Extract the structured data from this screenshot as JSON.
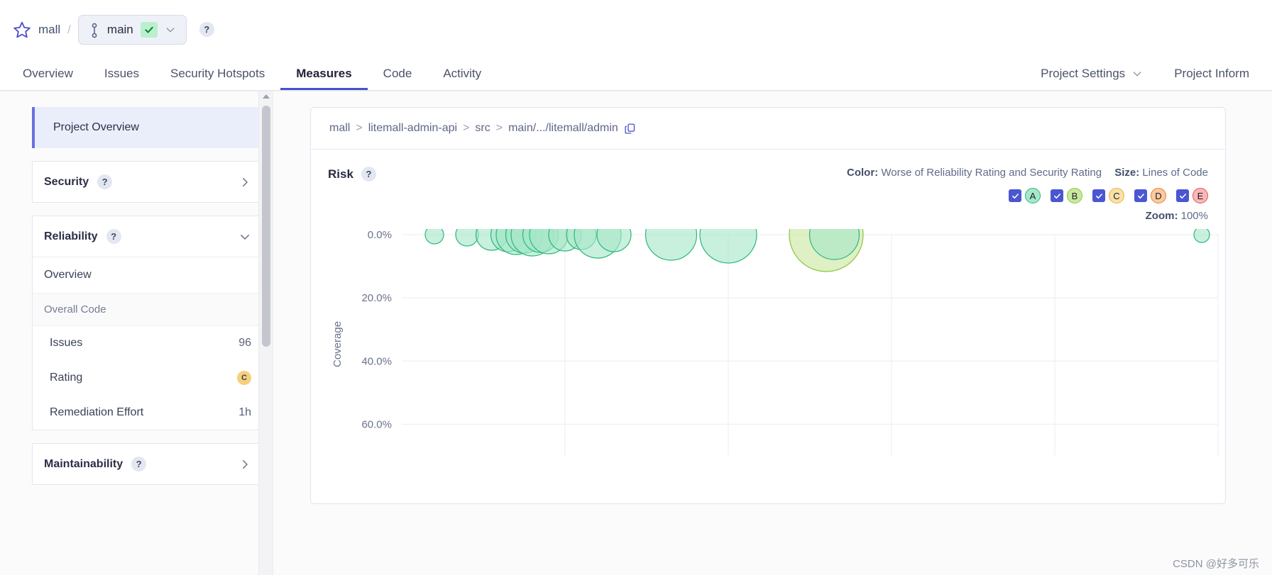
{
  "topbar": {
    "star_icon": "star-icon",
    "project": "mall",
    "separator": "/",
    "branch_icon": "branch-icon",
    "branch": "main",
    "quality_gate_icon": "check-icon",
    "branch_caret": "chevron-down-icon",
    "help": "?"
  },
  "nav": {
    "left": [
      {
        "label": "Overview",
        "active": false
      },
      {
        "label": "Issues",
        "active": false
      },
      {
        "label": "Security Hotspots",
        "active": false
      },
      {
        "label": "Measures",
        "active": true
      },
      {
        "label": "Code",
        "active": false
      },
      {
        "label": "Activity",
        "active": false
      }
    ],
    "right": [
      {
        "label": "Project Settings",
        "caret": true
      },
      {
        "label": "Project Inform",
        "caret": false
      }
    ]
  },
  "sidebar": {
    "overview_label": "Project Overview",
    "panels": [
      {
        "title": "Security",
        "help": "?",
        "expanded": false,
        "arrow": "chevron-right-icon"
      },
      {
        "title": "Reliability",
        "help": "?",
        "expanded": true,
        "arrow": "chevron-down-icon",
        "link": "Overview",
        "section": "Overall Code",
        "metrics": [
          {
            "label": "Issues",
            "value": "96",
            "type": "number"
          },
          {
            "label": "Rating",
            "value": "C",
            "type": "rating",
            "color": "#f5d07b"
          },
          {
            "label": "Remediation Effort",
            "value": "1h",
            "type": "number"
          }
        ]
      },
      {
        "title": "Maintainability",
        "help": "?",
        "expanded": false,
        "arrow": "chevron-right-icon"
      }
    ]
  },
  "main": {
    "breadcrumb": [
      {
        "label": "mall"
      },
      {
        "label": "litemall-admin-api"
      },
      {
        "label": "src"
      },
      {
        "label": "main/.../litemall/admin"
      }
    ],
    "breadcrumb_separator": ">",
    "copy_icon": "copy-icon",
    "chart_title": "Risk",
    "chart_help": "?",
    "legend": {
      "color_label": "Color:",
      "color_value": "Worse of Reliability Rating and Security Rating",
      "size_label": "Size:",
      "size_value": "Lines of Code"
    },
    "rating_filters": [
      {
        "label": "A",
        "checked": true,
        "fill": "#a5e8c8",
        "stroke": "#2cb87a"
      },
      {
        "label": "B",
        "checked": true,
        "fill": "#c9e8a0",
        "stroke": "#8ac73c"
      },
      {
        "label": "C",
        "checked": true,
        "fill": "#fae0a8",
        "stroke": "#e8b53c"
      },
      {
        "label": "D",
        "checked": true,
        "fill": "#fbcba0",
        "stroke": "#ef7c2b"
      },
      {
        "label": "E",
        "checked": true,
        "fill": "#f9b8b8",
        "stroke": "#e8504f"
      }
    ],
    "zoom_label": "Zoom:",
    "zoom_value": "100%",
    "watermark": "CSDN @好多可乐"
  },
  "chart_data": {
    "type": "scatter",
    "title": "Risk",
    "xlabel": "",
    "ylabel": "Coverage",
    "ylim": [
      0,
      70
    ],
    "y_inverted": true,
    "yticks": [
      "0.0%",
      "20.0%",
      "40.0%",
      "60.0%"
    ],
    "ytick_values": [
      0,
      20,
      40,
      60
    ],
    "grid": true,
    "color_metric": "Worse of Reliability Rating and Security Rating",
    "size_metric": "Lines of Code",
    "legend_position": "top-right",
    "points": [
      {
        "x": 4,
        "y": 0,
        "r": 13,
        "rating": "A"
      },
      {
        "x": 8,
        "y": 0,
        "r": 16,
        "rating": "A"
      },
      {
        "x": 11,
        "y": 0,
        "r": 22,
        "rating": "A"
      },
      {
        "x": 13,
        "y": 0,
        "r": 24,
        "rating": "A"
      },
      {
        "x": 14,
        "y": 0,
        "r": 28,
        "rating": "A"
      },
      {
        "x": 15,
        "y": 0,
        "r": 26,
        "rating": "A"
      },
      {
        "x": 16,
        "y": 0,
        "r": 30,
        "rating": "A"
      },
      {
        "x": 17,
        "y": 0,
        "r": 25,
        "rating": "A"
      },
      {
        "x": 18,
        "y": 0,
        "r": 27,
        "rating": "A"
      },
      {
        "x": 20,
        "y": 0,
        "r": 23,
        "rating": "A"
      },
      {
        "x": 22,
        "y": 0,
        "r": 21,
        "rating": "A"
      },
      {
        "x": 24,
        "y": 0,
        "r": 33,
        "rating": "A"
      },
      {
        "x": 26,
        "y": 0,
        "r": 24,
        "rating": "A"
      },
      {
        "x": 33,
        "y": 0,
        "r": 36,
        "rating": "A"
      },
      {
        "x": 40,
        "y": 0,
        "r": 40,
        "rating": "A"
      },
      {
        "x": 52,
        "y": 0,
        "r": 52,
        "rating": "B"
      },
      {
        "x": 53,
        "y": 0,
        "r": 35,
        "rating": "A"
      },
      {
        "x": 98,
        "y": 0,
        "r": 11,
        "rating": "A"
      }
    ]
  }
}
